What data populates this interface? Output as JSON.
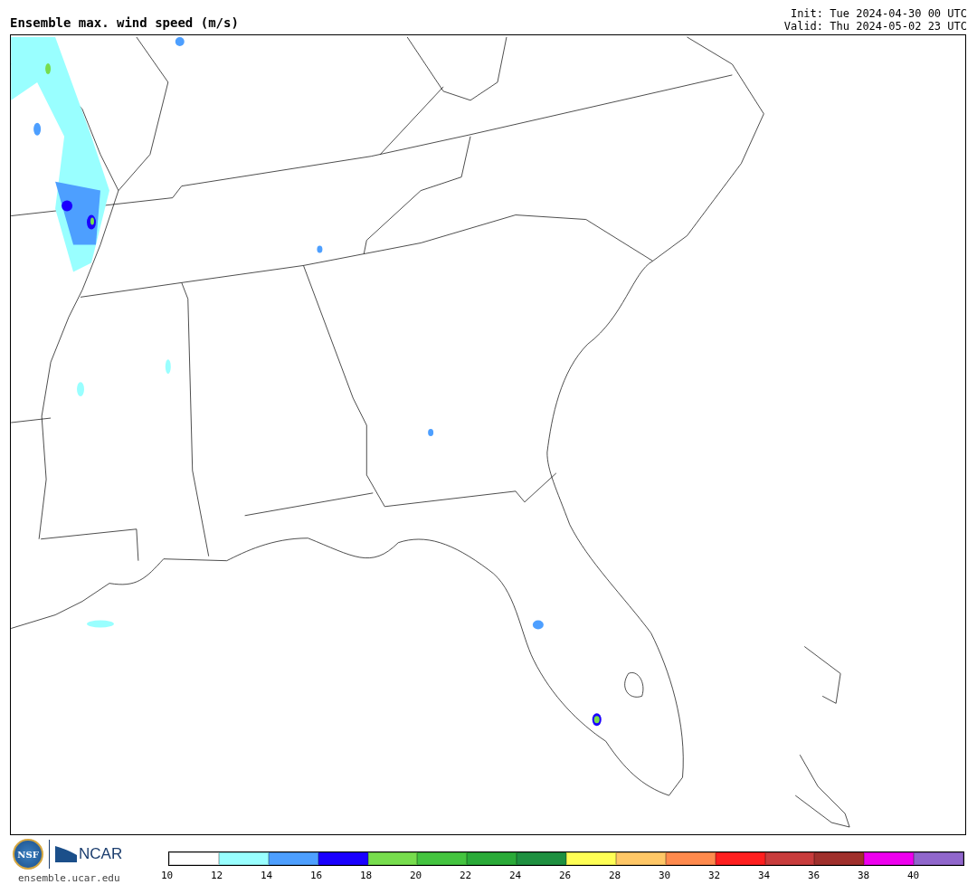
{
  "title": "Ensemble max. wind speed (m/s)",
  "init": "Init: Tue 2024-04-30 00 UTC",
  "valid": "Valid: Thu 2024-05-02 23 UTC",
  "logos": {
    "nsf": "NSF",
    "ncar": "NCAR",
    "url": "ensemble.ucar.edu"
  },
  "colorbar": [
    {
      "color": "#ffffff",
      "label": "10"
    },
    {
      "color": "#99ffff",
      "label": "12"
    },
    {
      "color": "#4d9fff",
      "label": "14"
    },
    {
      "color": "#1a00ff",
      "label": "16"
    },
    {
      "color": "#77dd4d",
      "label": "18"
    },
    {
      "color": "#44c43f",
      "label": "20"
    },
    {
      "color": "#2aaa38",
      "label": "22"
    },
    {
      "color": "#1e9040",
      "label": "24"
    },
    {
      "color": "#ffff55",
      "label": "26"
    },
    {
      "color": "#ffc766",
      "label": "28"
    },
    {
      "color": "#ff8a4d",
      "label": "30"
    },
    {
      "color": "#ff1f1f",
      "label": "32"
    },
    {
      "color": "#c83c3c",
      "label": "34"
    },
    {
      "color": "#a0302c",
      "label": "36"
    },
    {
      "color": "#ee00ee",
      "label": "38"
    },
    {
      "color": "#9066cc",
      "label": "40"
    }
  ]
}
